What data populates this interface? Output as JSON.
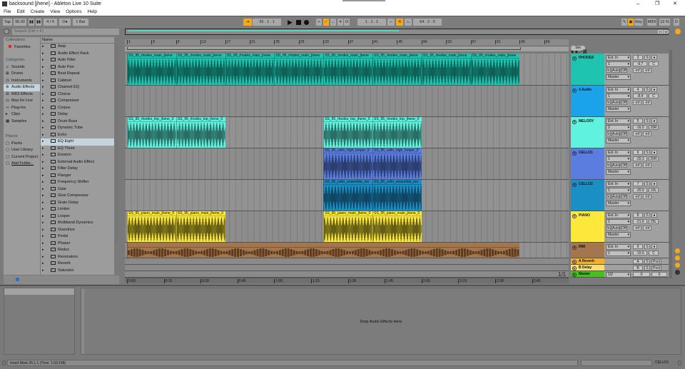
{
  "window": {
    "title": "backsound  [jhene] - Ableton Live 10 Suite",
    "logo": "Live"
  },
  "menu": [
    "File",
    "Edit",
    "Create",
    "View",
    "Options",
    "Help"
  ],
  "control": {
    "tap": "Tap",
    "tempo": "95.00",
    "signature": "4 / 4",
    "metro": "O●",
    "quantize": "1 Bar",
    "position": "26 .  1 .  1",
    "loop_start": "1 .  1 .  1",
    "loop_length": "64 .  2 .  0",
    "key": "Key",
    "midi": "MIDI",
    "cpu": "12 %",
    "d": "D"
  },
  "browser": {
    "search_placeholder": "Search (Ctrl + F)",
    "collections_header": "Collections",
    "favorites": "Favorites",
    "categories_header": "Categories",
    "categories": [
      "Sounds",
      "Drums",
      "Instruments",
      "Audio Effects",
      "MIDI Effects",
      "Max for Live",
      "Plug-Ins",
      "Clips",
      "Samples"
    ],
    "selected_category": "Audio Effects",
    "places_header": "Places",
    "places": [
      "Packs",
      "User Library",
      "Current Project",
      "Add Folder..."
    ],
    "name_header": "Name",
    "items": [
      "Amp",
      "Audio Effect Rack",
      "Auto Filter",
      "Auto Pan",
      "Beat Repeat",
      "Cabinet",
      "Channel EQ",
      "Chorus",
      "Compressor",
      "Corpus",
      "Delay",
      "Drum Buss",
      "Dynamic Tube",
      "Echo",
      "EQ Eight",
      "EQ Three",
      "Erosion",
      "External Audio Effect",
      "Filter Delay",
      "Flanger",
      "Frequency Shifter",
      "Gate",
      "Glue Compressor",
      "Grain Delay",
      "Limiter",
      "Looper",
      "Multiband Dynamics",
      "Overdrive",
      "Pedal",
      "Phaser",
      "Redux",
      "Resonators",
      "Reverb",
      "Saturator"
    ],
    "selected_item": "EQ Eight"
  },
  "ruler": {
    "bars": [
      "1",
      "5",
      "9",
      "13",
      "17",
      "21",
      "25",
      "29",
      "33",
      "37",
      "41",
      "45",
      "49",
      "53",
      "57",
      "61",
      "65",
      "69"
    ],
    "times": [
      "0:00",
      "0:15",
      "0:30",
      "0:45",
      "1:00",
      "1:15",
      "1:30",
      "1:45",
      "2:00",
      "2:15",
      "2:30",
      "2:45"
    ]
  },
  "set_label": "Set",
  "page_indicator": "1/1",
  "tracks": [
    {
      "name": "RHODES",
      "color": "#1ec4b0",
      "wave": "#0b3b35",
      "in": "Ext. In",
      "ch": "1",
      "num": "3",
      "vol": "-9.7",
      "pan": "C",
      "clips": [
        {
          "start": 1,
          "len": 8,
          "label": "SS_95_rhodes_main_jhene"
        },
        {
          "start": 9,
          "len": 8,
          "label": "SS_95_rhodes_main_jhene"
        },
        {
          "start": 17,
          "len": 8,
          "label": "SS_95_rhodes_main_jhene"
        },
        {
          "start": 25,
          "len": 8,
          "label": "SS_95_rhodes_main_jhene"
        },
        {
          "start": 33,
          "len": 8,
          "label": "SS_95_rhodes_main_jhene"
        },
        {
          "start": 41,
          "len": 8,
          "label": "SS_95_rhodes_main_jhene"
        },
        {
          "start": 49,
          "len": 8,
          "label": "SS_95_rhodes_main_jhene"
        },
        {
          "start": 57,
          "len": 8,
          "label": "SS_95_rhodes_main_jhene"
        }
      ]
    },
    {
      "name": "4 Audio",
      "color": "#1aa3e8",
      "wave": "#0b3b35",
      "in": "Ext. In",
      "ch": "1",
      "num": "4",
      "vol": "-8.4",
      "pan": "C",
      "clips": []
    },
    {
      "name": "MELODY",
      "color": "#5ff2de",
      "wave": "#173b37",
      "in": "Ext. In",
      "ch": "2",
      "num": "5",
      "vol": "-16.0",
      "pan": "29R",
      "clips": [
        {
          "start": 1,
          "len": 8,
          "label": "SS_95_rhodes_top_jhene_0"
        },
        {
          "start": 9,
          "len": 8,
          "label": "SS_95_rhodes_top_jhene_0"
        },
        {
          "start": 33,
          "len": 8,
          "label": "SS_95_rhodes_top_jhene_0"
        },
        {
          "start": 41,
          "len": 8,
          "label": "SS_95_rhodes_top_jhene_0"
        }
      ]
    },
    {
      "name": "CELLO1",
      "color": "#5b7de0",
      "wave": "#1a2745",
      "in": "Ext. In",
      "ch": "1",
      "num": "6",
      "vol": "-20.3",
      "pan": "20R",
      "clips": [
        {
          "start": 33,
          "len": 8,
          "label": "SS_95_cello_high_looper_0"
        },
        {
          "start": 41,
          "len": 8,
          "label": "SS_95_cello_high_looper_0"
        }
      ]
    },
    {
      "name": "CELLO2",
      "color": "#1a8fc6",
      "wave": "#0e2b3d",
      "in": "Ext. In",
      "ch": "1",
      "num": "7",
      "vol": "-20.9",
      "pan": "10L",
      "clips": [
        {
          "start": 33,
          "len": 8,
          "label": "SS_95_cello_ensemble_loo"
        },
        {
          "start": 41,
          "len": 8,
          "label": "SS_95_cello_ensemble_loo"
        }
      ]
    },
    {
      "name": "PIANO",
      "color": "#fbe83a",
      "wave": "#2d2a0a",
      "in": "Ext. In",
      "ch": "1",
      "num": "8",
      "vol": "-21.6",
      "pan": "25L",
      "clips": [
        {
          "start": 1,
          "len": 8,
          "label": "SS_95_piano_main_jhene_0"
        },
        {
          "start": 9,
          "len": 8,
          "label": "SS_95_piano_main_jhene_0"
        },
        {
          "start": 33,
          "len": 8,
          "label": "SS_95_piano_main_jhene_0"
        },
        {
          "start": 41,
          "len": 8,
          "label": "SS_95_piano_main_jhene_0"
        }
      ]
    },
    {
      "name": "RIM",
      "color": "#a3764e",
      "wave": "#5a3a20",
      "in": "Ext. In",
      "ch": "1",
      "num": "9",
      "vol": "-15.6",
      "pan": "C",
      "clips": [
        {
          "start": 1,
          "len": 64,
          "label": ""
        }
      ]
    }
  ],
  "common": {
    "in": "In",
    "auto": "Auto",
    "off": "Off",
    "master": "Master",
    "inf": "-inf",
    "s": "S"
  },
  "returns": [
    {
      "name": "A Reverb",
      "color": "#f0b030",
      "letter": "A",
      "post": "Post"
    },
    {
      "name": "B Delay",
      "color": "#f8e070",
      "letter": "B",
      "post": "Post"
    }
  ],
  "master": {
    "name": "Master",
    "color": "#46c020",
    "route": "1/2",
    "vol": "0",
    "pan": "0"
  },
  "detail": {
    "drop_text": "Drop Audio Effects Here"
  },
  "status": {
    "text": "Insert Mark 26.1.1 (Time: 1:03:158)",
    "track": "CELLO1"
  }
}
